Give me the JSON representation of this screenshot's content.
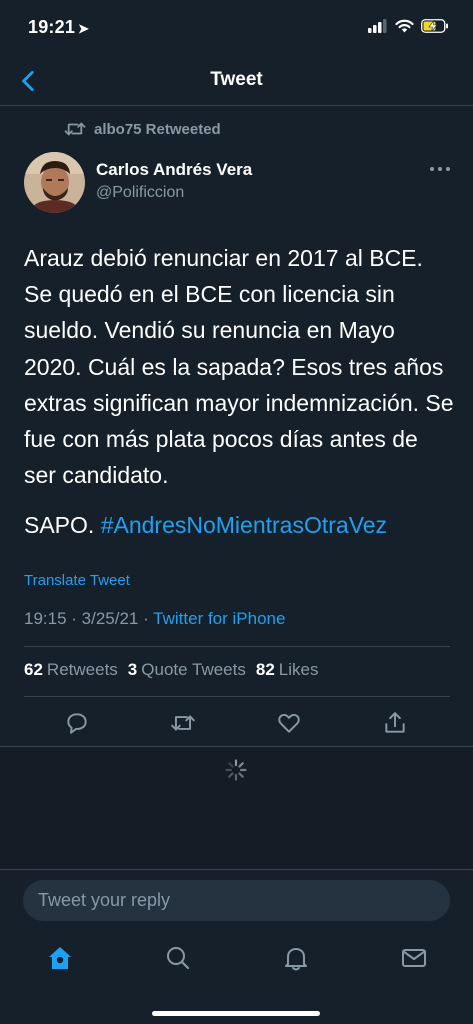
{
  "status_bar": {
    "time": "19:21",
    "location_icon": "location-arrow-icon",
    "signal_icon": "cellular-signal-icon",
    "wifi_icon": "wifi-icon",
    "battery_icon": "battery-charging-icon"
  },
  "nav": {
    "title": "Tweet",
    "back_icon": "chevron-left-icon"
  },
  "tweet": {
    "retweeted_by": "albo75 Retweeted",
    "author_name": "Carlos Andrés Vera",
    "author_handle": "@Polificcion",
    "body": "Arauz debió renunciar en 2017 al BCE. Se quedó en el BCE con licencia sin sueldo. Vendió su renuncia en Mayo 2020. Cuál es la sapada? Esos tres años extras significan mayor indemnización. Se fue con más plata pocos días antes de ser candidato.",
    "tail_text": "SAPO.",
    "hashtag": "#AndresNoMientrasOtraVez",
    "translate_label": "Translate Tweet",
    "timestamp": "19:15 · 3/25/21 · ",
    "client": "Twitter for iPhone",
    "stats": {
      "retweets_count": "62",
      "retweets_label": "Retweets",
      "quote_count": "3",
      "quote_label": "Quote Tweets",
      "likes_count": "82",
      "likes_label": "Likes"
    }
  },
  "reply": {
    "placeholder": "Tweet your reply"
  },
  "tabbar": {
    "items": [
      "home-icon",
      "search-icon",
      "notifications-icon",
      "messages-icon"
    ],
    "active": "home-icon"
  },
  "colors": {
    "background": "#15202b",
    "accent": "#1da1f2",
    "muted": "#8899a6",
    "border": "#38444d"
  }
}
